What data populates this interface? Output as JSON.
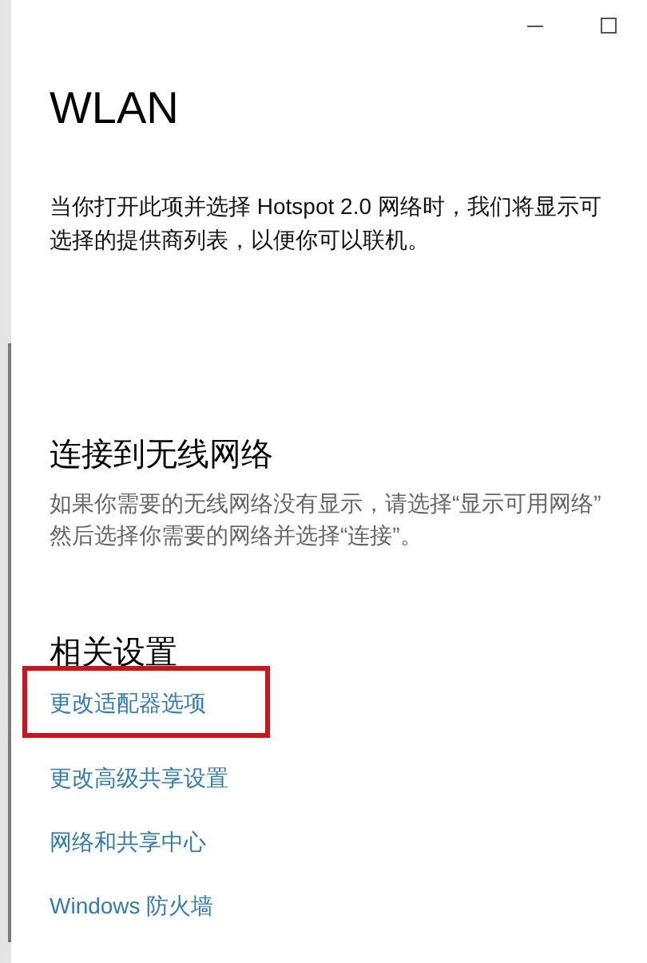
{
  "window": {
    "title": "WLAN"
  },
  "hotspot_description": [
    "当你打开此项并选择 Hotspot 2.0 网络时，我们将显示可",
    "选择的提供商列表，以便你可以联机。"
  ],
  "connect_section": {
    "heading": "连接到无线网络",
    "description": [
      "如果你需要的无线网络没有显示，请选择“显示可用网络”",
      "然后选择你需要的网络并选择“连接”。"
    ]
  },
  "related_settings": {
    "heading": "相关设置",
    "links": [
      {
        "label": "更改适配器选项",
        "highlighted": true
      },
      {
        "label": "更改高级共享设置",
        "highlighted": false
      },
      {
        "label": "网络和共享中心",
        "highlighted": false
      },
      {
        "label": "Windows 防火墙",
        "highlighted": false
      }
    ]
  }
}
